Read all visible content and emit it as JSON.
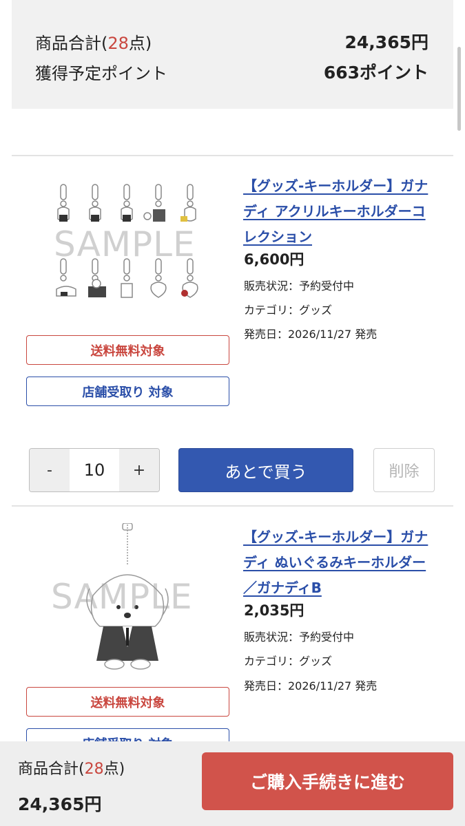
{
  "summary": {
    "total_label_prefix": "商品合計(",
    "total_count": "28",
    "total_label_suffix": "点)",
    "total_price": "24,365円",
    "points_label": "獲得予定ポイント",
    "points_value": "663ポイント"
  },
  "products": [
    {
      "title": "【グッズ-キーホルダー】ガナディ アクリルキーホルダーコレクション",
      "title_lines": [
        "【グッズ-キーホルダー】ガナ",
        "ディ アクリルキーホルダーコ",
        "レクション"
      ],
      "price": "6,600円",
      "status": "販売状況：予約受付中",
      "category": "カテゴリ：グッズ",
      "release": "発売日：2026/11/27 発売",
      "badge_shipping": "送料無料対象",
      "badge_store": "店舗受取り 対象",
      "image_watermark": "SAMPLE",
      "quantity": "10",
      "minus": "-",
      "plus": "+",
      "later_button": "あとで買う",
      "delete_button": "削除"
    },
    {
      "title": "【グッズ-キーホルダー】ガナディ ぬいぐるみキーホルダー／ガナディB",
      "title_lines": [
        "【グッズ-キーホルダー】ガナ",
        "ディ ぬいぐるみキーホルダー",
        "／ガナディB"
      ],
      "price": "2,035円",
      "status": "販売状況：予約受付中",
      "category": "カテゴリ：グッズ",
      "release": "発売日：2026/11/27 発売",
      "badge_shipping": "送料無料対象",
      "badge_store": "店舗受取り 対象",
      "image_watermark": "SAMPLE"
    }
  ],
  "footer": {
    "total_label_prefix": "商品合計(",
    "total_count": "28",
    "total_label_suffix": "点)",
    "total_price": "24,365円",
    "checkout_button": "ご購入手続きに進む"
  },
  "colors": {
    "accent_red": "#c9463e",
    "link_blue": "#2a4ea8",
    "button_blue": "#3358b0",
    "checkout_red": "#d1534b"
  }
}
